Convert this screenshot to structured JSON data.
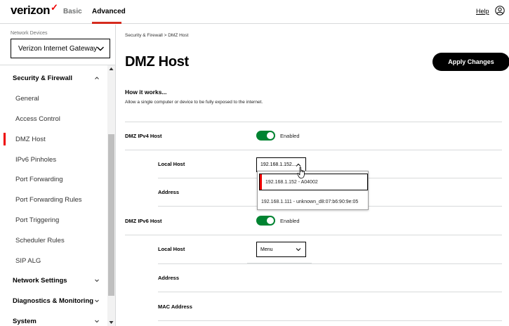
{
  "header": {
    "logo_text": "verizon",
    "logo_mark": "✓",
    "tabs": [
      {
        "label": "Basic",
        "active": false
      },
      {
        "label": "Advanced",
        "active": true
      }
    ],
    "help_label": "Help",
    "user_icon": "user-icon"
  },
  "sidebar": {
    "devices_label": "Network Devices",
    "device_selected": "Verizon Internet Gateway",
    "items": [
      {
        "label": "Security & Firewall",
        "type": "section",
        "expanded": true
      },
      {
        "label": "General",
        "type": "sub"
      },
      {
        "label": "Access Control",
        "type": "sub"
      },
      {
        "label": "DMZ Host",
        "type": "sub",
        "active": true
      },
      {
        "label": "IPv6 Pinholes",
        "type": "sub"
      },
      {
        "label": "Port Forwarding",
        "type": "sub"
      },
      {
        "label": "Port Forwarding Rules",
        "type": "sub"
      },
      {
        "label": "Port Triggering",
        "type": "sub"
      },
      {
        "label": "Scheduler Rules",
        "type": "sub"
      },
      {
        "label": "SIP ALG",
        "type": "sub"
      },
      {
        "label": "Network Settings",
        "type": "section",
        "expanded": false
      },
      {
        "label": "Diagnostics & Monitoring",
        "type": "section",
        "expanded": false
      },
      {
        "label": "System",
        "type": "section",
        "expanded": false
      }
    ]
  },
  "main": {
    "breadcrumb": "Security & Firewall  >  DMZ Host",
    "title": "DMZ Host",
    "apply_label": "Apply Changes",
    "how_title": "How it works...",
    "how_text": "Allow a single computer or device to be fully exposed to the internet.",
    "ipv4": {
      "label": "DMZ IPv4 Host",
      "toggle_text": "Enabled",
      "enabled": true,
      "local_host_label": "Local Host",
      "local_host_value": "192.168.1.152...",
      "address_label": "Address",
      "dropdown_options": [
        "192.168.1.152 - A04002",
        "192.168.1.111 - unknown_d8:07:b6:90:9e:05"
      ]
    },
    "ipv6": {
      "label": "DMZ IPv6 Host",
      "toggle_text": "Enabled",
      "enabled": true,
      "local_host_label": "Local Host",
      "local_host_value": "Menu",
      "address_label": "Address",
      "mac_label": "MAC Address"
    }
  },
  "colors": {
    "accent_red": "#ee0000",
    "toggle_green": "#008331",
    "button_black": "#000000"
  }
}
